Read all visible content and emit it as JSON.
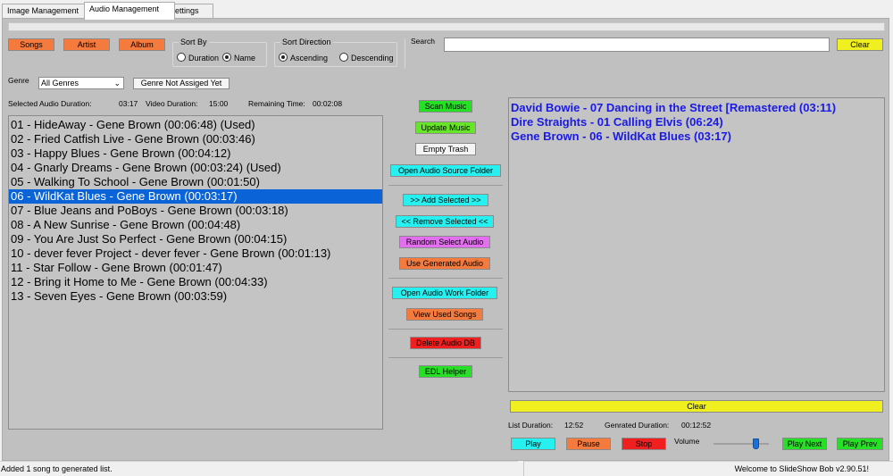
{
  "tabs": [
    "Image Management",
    "Audio Management",
    "Settings"
  ],
  "top_buttons": {
    "songs": "Songs",
    "artist": "Artist",
    "album": "Album"
  },
  "sort_by": {
    "title": "Sort By",
    "duration": "Duration",
    "name": "Name",
    "selected": "name"
  },
  "sort_direction": {
    "title": "Sort Direction",
    "ascending": "Ascending",
    "descending": "Descending",
    "selected": "ascending"
  },
  "search": {
    "label": "Search",
    "value": "",
    "clear_label": "Clear"
  },
  "genre": {
    "label": "Genre",
    "value": "All Genres",
    "not_assigned_label": "Genre Not Assiged Yet"
  },
  "durations": {
    "selected_label": "Selected Audio Duration:",
    "selected_value": "03:17",
    "video_label": "Video Duration:",
    "video_value": "15:00",
    "remaining_label": "Remaining Time:",
    "remaining_value": "00:02:08"
  },
  "songs": [
    "01 - HideAway - Gene Brown (00:06:48) (Used)",
    "02 - Fried Catfish Live - Gene Brown (00:03:46)",
    "03 - Happy Blues - Gene Brown (00:04:12)",
    "04 - Gnarly Dreams - Gene Brown (00:03:24) (Used)",
    "05 - Walking To School - Gene Brown (00:01:50)",
    "06 - WildKat Blues - Gene Brown (00:03:17)",
    "07 - Blue Jeans and PoBoys - Gene Brown (00:03:18)",
    "08 - A New Sunrise - Gene Brown (00:04:48)",
    "09 - You Are Just So Perfect - Gene Brown (00:04:15)",
    "10 - dever fever Project - dever fever - Gene Brown (00:01:13)",
    "11 - Star Follow - Gene Brown (00:01:47)",
    "12 - Bring it Home to Me - Gene Brown (00:04:33)",
    "13 - Seven Eyes - Gene Brown (00:03:59)"
  ],
  "selected_song_index": 5,
  "middle_buttons": {
    "scan": "Scan Music",
    "update": "Update Music",
    "empty_trash": "Empty Trash",
    "open_source": "Open Audio Source Folder",
    "add_selected": ">> Add Selected >>",
    "remove_selected": "<< Remove Selected <<",
    "random_select": "Random Select Audio",
    "use_generated": "Use Generated Audio",
    "open_work": "Open Audio Work Folder",
    "view_used": "View Used Songs",
    "delete_db": "Delete Audio DB",
    "edl_helper": "EDL Helper"
  },
  "generated": [
    "David Bowie - 07 Dancing in the Street [Remastered (03:11)",
    "Dire Straights - 01 Calling Elvis (06:24)",
    "Gene Brown - 06 - WildKat Blues (03:17)"
  ],
  "generated_clear_label": "Clear",
  "list_info": {
    "list_label": "List Duration:",
    "list_value": "12:52",
    "generated_label": "Genrated Duration:",
    "generated_value": "00:12:52"
  },
  "playback": {
    "play": "Play",
    "pause": "Pause",
    "stop": "Stop",
    "volume_label": "Volume",
    "volume_level": 0.78,
    "play_next": "Play Next",
    "play_prev": "Play Prev"
  },
  "status": {
    "left": "Added 1 song to generated list.",
    "right": "Welcome to SlideShow Bob v2.90.51!"
  },
  "colors": {
    "panel": "#c0c0c0",
    "selection": "#0a64d8",
    "generated_text": "#1a1ae6",
    "orange": "#f57a3d",
    "green": "#26e026",
    "cyan": "#26f0f0",
    "violet": "#e46ef0",
    "red": "#f02020",
    "yellow": "#f0f020"
  }
}
